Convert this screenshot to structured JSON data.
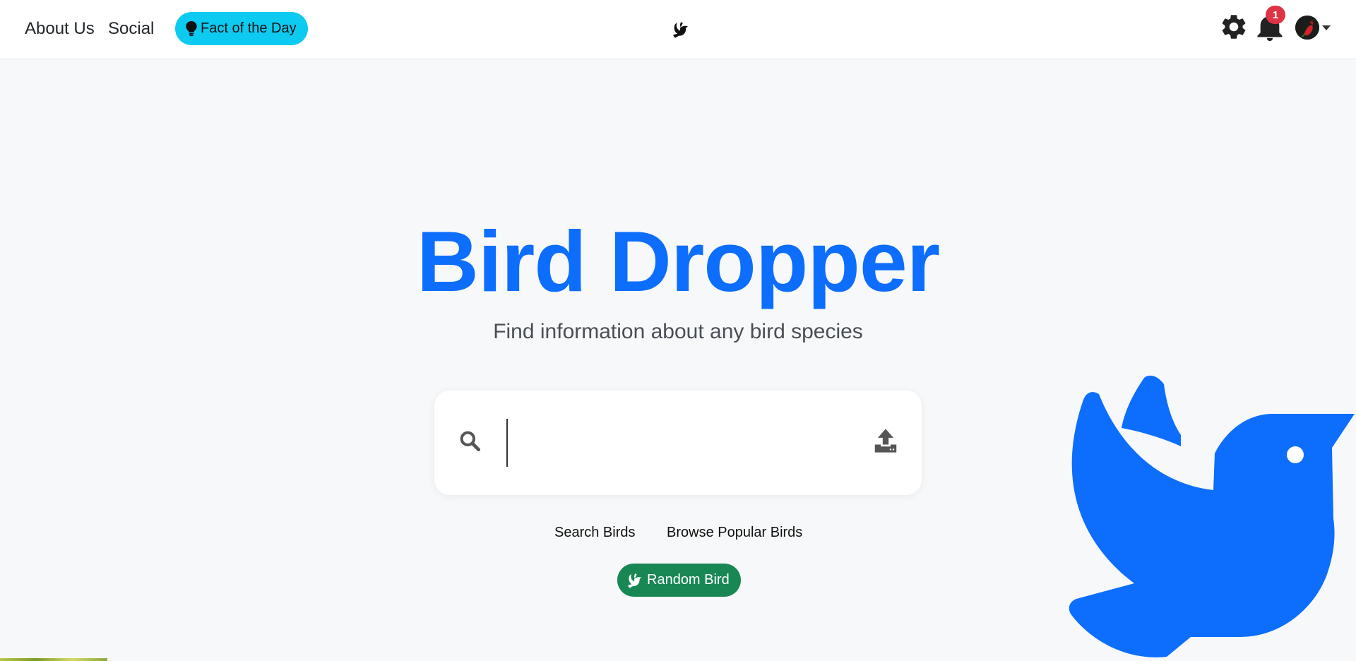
{
  "navbar": {
    "links": [
      {
        "label": "About Us"
      },
      {
        "label": "Social"
      }
    ],
    "fact_button": {
      "label": "Fact of the Day",
      "icon": "lightbulb-icon"
    },
    "logo_icon": "dove-icon",
    "settings_icon": "gear-icon",
    "notifications": {
      "icon": "bell-icon",
      "count": "1"
    },
    "user_menu": {
      "avatar": "cardinal-avatar",
      "icon": "caret-down-icon"
    }
  },
  "hero": {
    "title": "Bird Dropper",
    "subtitle": "Find information about any bird species"
  },
  "search": {
    "value": "",
    "placeholder": "",
    "search_icon": "search-icon",
    "upload_icon": "upload-icon"
  },
  "links": {
    "search_birds": "Search Birds",
    "browse_popular": "Browse Popular Birds"
  },
  "random_button": {
    "label": "Random Bird",
    "icon": "dove-icon"
  },
  "colors": {
    "primary": "#0d6efd",
    "info": "#0dcaf0",
    "success": "#198754",
    "danger": "#dc3545",
    "background": "#f7f8fa"
  }
}
